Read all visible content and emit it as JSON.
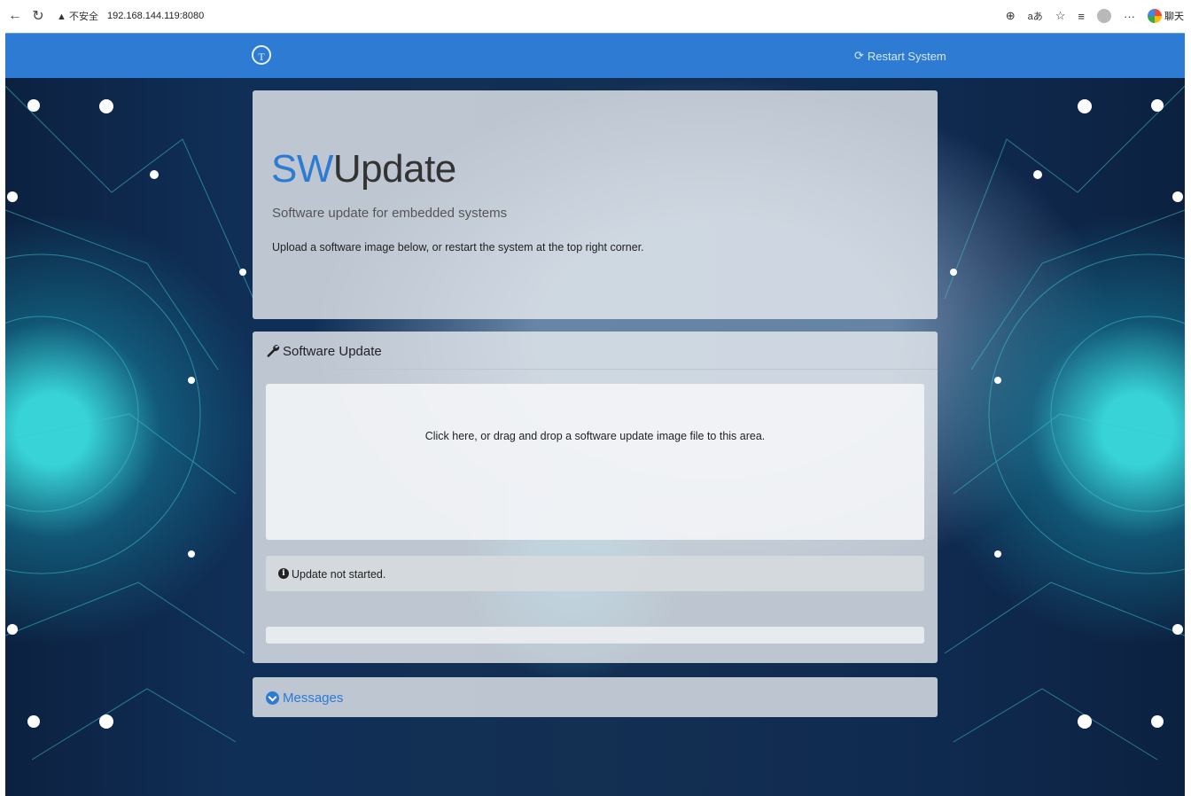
{
  "browser": {
    "back_icon": "arrow-left-icon",
    "reload_icon": "reload-icon",
    "security_warning": "▲ 不安全",
    "url": "192.168.144.119:8080",
    "chat_label": "聊天"
  },
  "navbar": {
    "logo_glyph": "T",
    "restart_label": "Restart System",
    "bg_color": "#2d7bd3"
  },
  "jumbotron": {
    "title_accent": "SW",
    "title_rest": "Update",
    "tagline": "Software update for embedded systems",
    "intro": "Upload a software image below, or restart the system at the top right corner."
  },
  "update_panel": {
    "title": "Software Update",
    "dropzone_text": "Click here, or drag and drop a software update image file to this area.",
    "status_text": "Update not started.",
    "progress": 0
  },
  "messages": {
    "label": "Messages"
  }
}
